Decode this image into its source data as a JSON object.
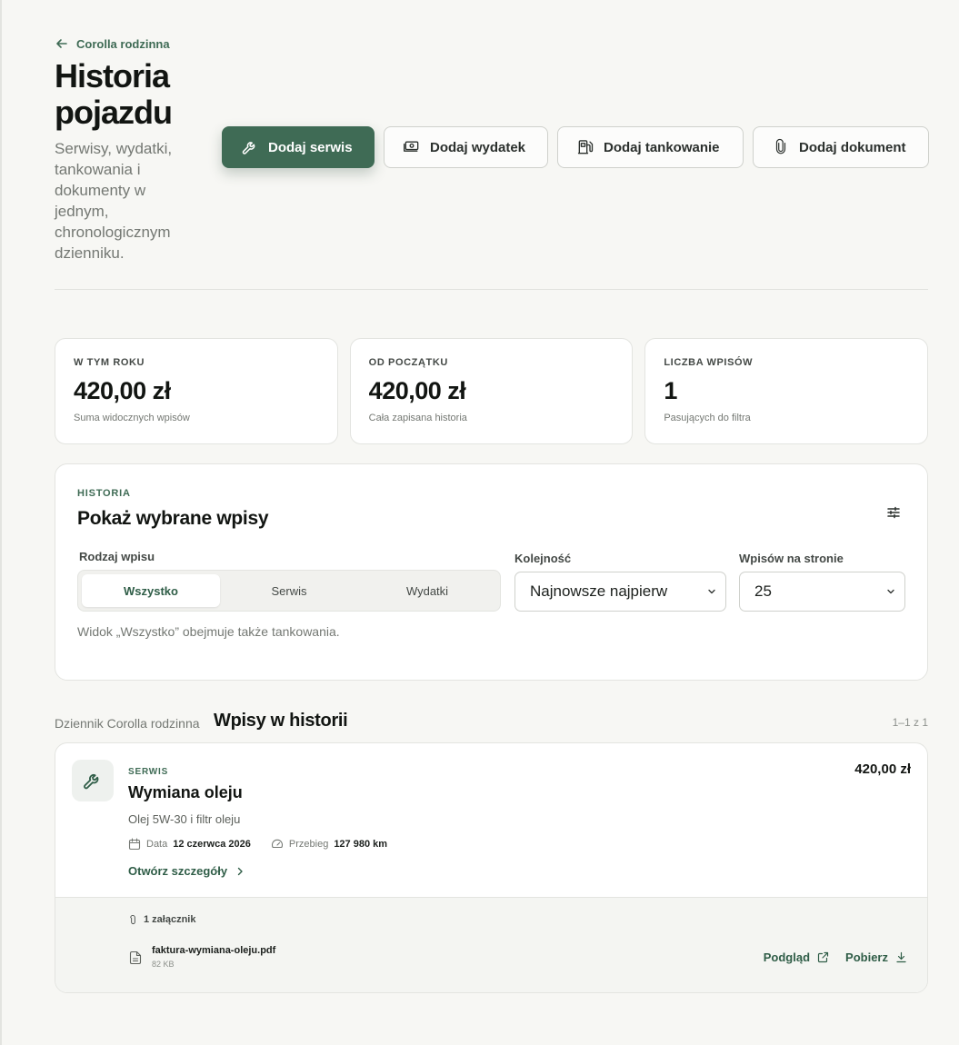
{
  "header": {
    "back_label": "Corolla rodzinna",
    "title": "Historia pojazdu",
    "subtitle": "Serwisy, wydatki, tankowania i dokumenty w jednym, chronologicznym dzienniku."
  },
  "actions": [
    {
      "label": "Dodaj serwis",
      "icon": "wrench-icon",
      "primary": true
    },
    {
      "label": "Dodaj wydatek",
      "icon": "banknote-icon",
      "primary": false
    },
    {
      "label": "Dodaj tankowanie",
      "icon": "fuel-pump-icon",
      "primary": false
    },
    {
      "label": "Dodaj dokument",
      "icon": "paperclip-icon",
      "primary": false
    }
  ],
  "stats": [
    {
      "label": "W TYM ROKU",
      "value": "420,00 zł",
      "note": "Suma widocznych wpisów"
    },
    {
      "label": "OD POCZĄTKU",
      "value": "420,00 zł",
      "note": "Cała zapisana historia"
    },
    {
      "label": "LICZBA WPISÓW",
      "value": "1",
      "note": "Pasujących do filtra"
    }
  ],
  "filters": {
    "eyebrow": "HISTORIA",
    "title": "Pokaż wybrane wpisy",
    "type_label": "Rodzaj wpisu",
    "type_options": [
      "Wszystko",
      "Serwis",
      "Wydatki"
    ],
    "type_selected": "Wszystko",
    "order_label": "Kolejność",
    "order_value": "Najnowsze najpierw",
    "per_page_label": "Wpisów na stronie",
    "per_page_value": "25",
    "hint": "Widok „Wszystko” obejmuje także tankowania."
  },
  "list": {
    "subtitle": "Dziennik Corolla rodzinna",
    "title": "Wpisy w historii",
    "count": "1–1 z 1"
  },
  "entries": [
    {
      "category": "SERWIS",
      "title": "Wymiana oleju",
      "amount": "420,00 zł",
      "description": "Olej 5W-30 i filtr oleju",
      "date_label": "Data",
      "date_value": "12 czerwca 2026",
      "mileage_label": "Przebieg",
      "mileage_value": "127 980 km",
      "details_link": "Otwórz szczegóły",
      "attachments_count": "1 załącznik",
      "file_name": "faktura-wymiana-oleju.pdf",
      "file_size": "82 KB",
      "preview_label": "Podgląd",
      "download_label": "Pobierz"
    }
  ],
  "colors": {
    "accent": "#3f6b55",
    "background": "#f7f7f4"
  }
}
